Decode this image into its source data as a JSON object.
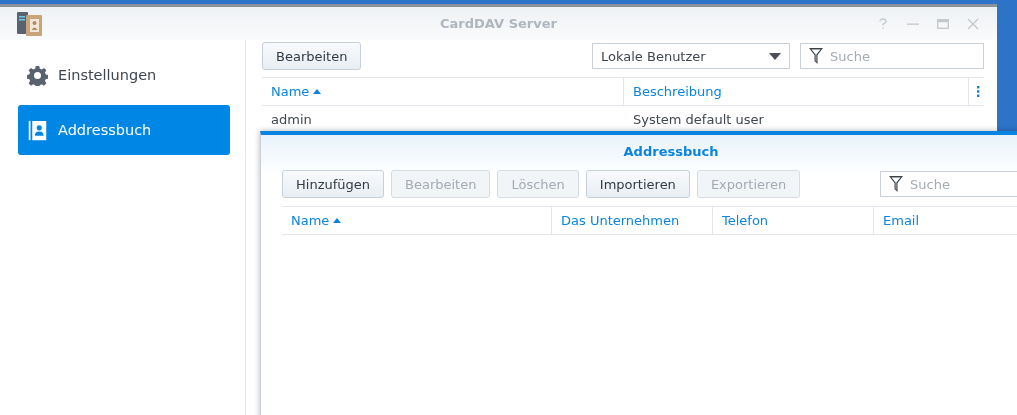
{
  "window": {
    "title": "CardDAV Server"
  },
  "sidebar": {
    "items": [
      {
        "label": "Einstellungen",
        "kind": "settings",
        "selected": false
      },
      {
        "label": "Addressbuch",
        "kind": "book",
        "selected": true
      }
    ]
  },
  "toolbar": {
    "edit_button": {
      "label": "Bearbeiten",
      "disabled": false
    },
    "user_filter": {
      "value": "Lokale Benutzer"
    },
    "search": {
      "placeholder": "Suche"
    }
  },
  "table": {
    "columns": [
      {
        "label": "Name",
        "sorted": true
      },
      {
        "label": "Beschreibung",
        "sorted": false
      }
    ],
    "rows": [
      {
        "cells": [
          "admin",
          "System default user"
        ]
      }
    ]
  },
  "dialog": {
    "title": "Addressbuch",
    "buttons": [
      {
        "label": "Hinzufügen",
        "disabled": false
      },
      {
        "label": "Bearbeiten",
        "disabled": true
      },
      {
        "label": "Löschen",
        "disabled": true
      },
      {
        "label": "Importieren",
        "disabled": false
      },
      {
        "label": "Exportieren",
        "disabled": true
      }
    ],
    "search": {
      "placeholder": "Suche"
    },
    "columns": [
      {
        "label": "Name",
        "sorted": true
      },
      {
        "label": "Das Unternehmen",
        "sorted": false
      },
      {
        "label": "Telefon",
        "sorted": false
      },
      {
        "label": "Email",
        "sorted": false
      }
    ]
  }
}
